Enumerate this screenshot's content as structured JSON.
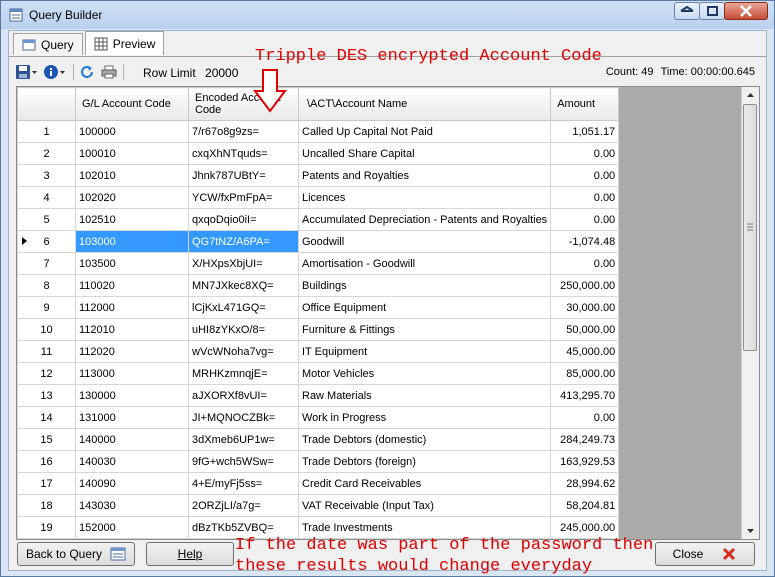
{
  "window": {
    "title": "Query Builder"
  },
  "tabs": [
    {
      "label": "Query",
      "icon": "query-icon"
    },
    {
      "label": "Preview",
      "icon": "preview-icon"
    }
  ],
  "toolbar": {
    "row_limit_label": "Row Limit",
    "row_limit_value": "20000",
    "count_text": "Count: 49",
    "time_text": "Time: 00:00:00.645"
  },
  "grid": {
    "columns": [
      "G/L Account Code",
      "Encoded Account Code",
      "\\ACT\\Account Name",
      "Amount"
    ],
    "selected_row": 6,
    "rows": [
      {
        "n": "1",
        "code": "100000",
        "enc": "7/r67o8g9zs=",
        "name": "Called Up Capital Not Paid",
        "amount": "1,051.17"
      },
      {
        "n": "2",
        "code": "100010",
        "enc": "cxqXhNTquds=",
        "name": "Uncalled Share Capital",
        "amount": "0.00"
      },
      {
        "n": "3",
        "code": "102010",
        "enc": "Jhnk787UBtY=",
        "name": "Patents and Royalties",
        "amount": "0.00"
      },
      {
        "n": "4",
        "code": "102020",
        "enc": "YCW/fxPmFpA=",
        "name": "Licences",
        "amount": "0.00"
      },
      {
        "n": "5",
        "code": "102510",
        "enc": "qxqoDqio0iI=",
        "name": "Accumulated Depreciation - Patents and Royalties",
        "amount": "0.00"
      },
      {
        "n": "6",
        "code": "103000",
        "enc": "QG7tNZ/A6PA=",
        "name": "Goodwill",
        "amount": "-1,074.48"
      },
      {
        "n": "7",
        "code": "103500",
        "enc": "X/HXpsXbjUI=",
        "name": "Amortisation - Goodwill",
        "amount": "0.00"
      },
      {
        "n": "8",
        "code": "110020",
        "enc": "MN7JXkec8XQ=",
        "name": "Buildings",
        "amount": "250,000.00"
      },
      {
        "n": "9",
        "code": "112000",
        "enc": "lCjKxL471GQ=",
        "name": "Office Equipment",
        "amount": "30,000.00"
      },
      {
        "n": "10",
        "code": "112010",
        "enc": "uHI8zYKxO/8=",
        "name": "Furniture & Fittings",
        "amount": "50,000.00"
      },
      {
        "n": "11",
        "code": "112020",
        "enc": "wVcWNoha7vg=",
        "name": "IT Equipment",
        "amount": "45,000.00"
      },
      {
        "n": "12",
        "code": "113000",
        "enc": "MRHKzmnqjE=",
        "name": "Motor Vehicles",
        "amount": "85,000.00"
      },
      {
        "n": "13",
        "code": "130000",
        "enc": "aJXORXf8vUI=",
        "name": "Raw Materials",
        "amount": "413,295.70"
      },
      {
        "n": "14",
        "code": "131000",
        "enc": "JI+MQNOCZBk=",
        "name": "Work in Progress",
        "amount": "0.00"
      },
      {
        "n": "15",
        "code": "140000",
        "enc": "3dXmeb6UP1w=",
        "name": "Trade Debtors (domestic)",
        "amount": "284,249.73"
      },
      {
        "n": "16",
        "code": "140030",
        "enc": "9fG+wch5WSw=",
        "name": "Trade Debtors (foreign)",
        "amount": "163,929.53"
      },
      {
        "n": "17",
        "code": "140090",
        "enc": "4+E/myFj5ss=",
        "name": "Credit Card Receivables",
        "amount": "28,994.62"
      },
      {
        "n": "18",
        "code": "143030",
        "enc": "2ORZjLI/a7g=",
        "name": "VAT Receivable (Input Tax)",
        "amount": "58,204.81"
      },
      {
        "n": "19",
        "code": "152000",
        "enc": "dBzTKb5ZVBQ=",
        "name": "Trade Investments",
        "amount": "245,000.00"
      }
    ]
  },
  "buttons": {
    "back": "Back to Query",
    "help": "Help",
    "close": "Close"
  },
  "annotations": {
    "top": "Tripple DES encrypted Account Code",
    "bottom_line1": "If the date was part of the password then",
    "bottom_line2": "these results would change everyday"
  },
  "colors": {
    "selection": "#3399ff",
    "annotation": "#e00000",
    "grid_background": "#ababab"
  }
}
